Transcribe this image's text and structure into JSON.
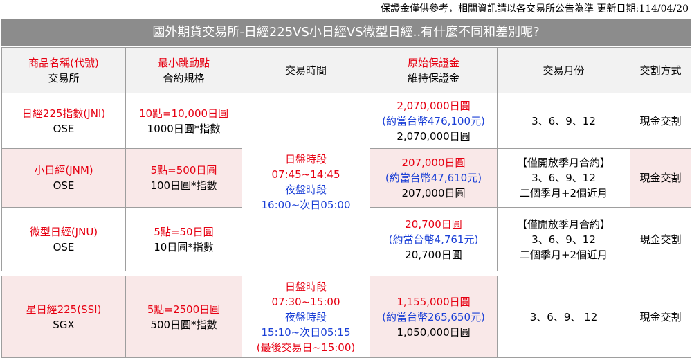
{
  "top_note": "保證金僅供參考，相關資訊請以各交易所公告為準  更新日期:114/04/20",
  "title": "國外期貨交易所-日經225VS小日經VS微型日經..有什麼不同和差別呢?",
  "header": {
    "col1_line1": "商品名稱(代號)",
    "col1_line2": "交易所",
    "col2_line1": "最小跳動點",
    "col2_line2": "合約規格",
    "col3": "交易時間",
    "col4_line1": "原始保證金",
    "col4_line2": "維持保證金",
    "col5": "交易月份",
    "col6": "交割方式"
  },
  "rows": [
    {
      "name": "日經225指數(JNI)",
      "exchange": "OSE",
      "tick": "10點=10,000日圓",
      "spec": "1000日圓*指數",
      "margin": "2,070,000日圓",
      "margin_twd": "(約當台幣476,100元)",
      "maint": "2,070,000日圓",
      "months_note": "",
      "months": "3、6、9、12",
      "months_extra": "",
      "settle": "現金交割"
    },
    {
      "name": "小日經(JNM)",
      "exchange": "OSE",
      "tick": "5點=500日圓",
      "spec": "100日圓*指數",
      "margin": "207,000日圓",
      "margin_twd": "(約當台幣47,610元)",
      "maint": "207,000日圓",
      "months_note": "【僅開放季月合約】",
      "months": "3、6、9、12",
      "months_extra": "二個季月+2個近月",
      "settle": "現金交割"
    },
    {
      "name": "微型日經(JNU)",
      "exchange": "OSE",
      "tick": "5點=50日圓",
      "spec": "10日圓*指數",
      "margin": "20,700日圓",
      "margin_twd": "(約當台幣4,761元)",
      "maint": "20,700日圓",
      "months_note": "【僅開放季月合約】",
      "months": "3、6、9、12",
      "months_extra": "二個季月+2個近月",
      "settle": "現金交割"
    },
    {
      "name": "星日經225(SSI)",
      "exchange": "SGX",
      "tick": "5點=2500日圓",
      "spec": "500日圓*指數",
      "margin": "1,155,000日圓",
      "margin_twd": "(約當台幣265,650元)",
      "maint": "1,050,000日圓",
      "months_note": "",
      "months": "3、6、9、 12",
      "months_extra": "",
      "settle": "現金交割"
    }
  ],
  "ose_hours": {
    "day_label": "日盤時段",
    "day_time": "07:45~14:45",
    "night_label": "夜盤時段",
    "night_time": "16:00~次日05:00"
  },
  "sgx_hours": {
    "day_label": "日盤時段",
    "day_time": "07:30~15:00",
    "night_label": "夜盤時段",
    "night_time": "15:10~次日05:15",
    "last_day": "(最後交易日~15:00)"
  },
  "colors": {
    "red": "#e60012",
    "blue": "#1a3fd6",
    "title_bg": "#8c8c8c",
    "pink_row": "#f9e8e8"
  }
}
